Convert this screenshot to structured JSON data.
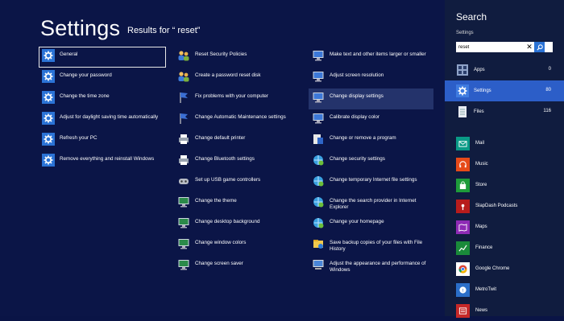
{
  "header": {
    "title": "Settings",
    "subtitle": "Results for “ reset”"
  },
  "columns": [
    [
      {
        "label": "General",
        "icon": "gear-icon",
        "focused": true
      },
      {
        "label": "Change your password",
        "icon": "gear-icon"
      },
      {
        "label": "Change the time zone",
        "icon": "gear-icon"
      },
      {
        "label": "Adjust for daylight saving time automatically",
        "icon": "gear-icon"
      },
      {
        "label": "Refresh your PC",
        "icon": "gear-icon"
      },
      {
        "label": "Remove everything and reinstall Windows",
        "icon": "gear-icon"
      }
    ],
    [
      {
        "label": "Reset Security Policies",
        "icon": "users-icon"
      },
      {
        "label": "Create a password reset disk",
        "icon": "users-icon"
      },
      {
        "label": "Fix problems with your computer",
        "icon": "flag-icon"
      },
      {
        "label": "Change Automatic Maintenance settings",
        "icon": "flag-icon"
      },
      {
        "label": "Change default printer",
        "icon": "printer-icon"
      },
      {
        "label": "Change Bluetooth settings",
        "icon": "printer-icon"
      },
      {
        "label": "Set up USB game controllers",
        "icon": "gamepad-icon"
      },
      {
        "label": "Change the theme",
        "icon": "monitor-icon"
      },
      {
        "label": "Change desktop background",
        "icon": "monitor-icon"
      },
      {
        "label": "Change window colors",
        "icon": "monitor-icon"
      },
      {
        "label": "Change screen saver",
        "icon": "monitor-icon"
      }
    ],
    [
      {
        "label": "Make text and other items larger or smaller",
        "icon": "display-icon"
      },
      {
        "label": "Adjust screen resolution",
        "icon": "display-icon"
      },
      {
        "label": "Change display settings",
        "icon": "display-icon",
        "highlighted": true
      },
      {
        "label": "Calibrate display color",
        "icon": "display-icon"
      },
      {
        "label": "Change or remove a program",
        "icon": "program-icon"
      },
      {
        "label": "Change security settings",
        "icon": "internet-options-icon"
      },
      {
        "label": "Change temporary Internet file settings",
        "icon": "internet-options-icon"
      },
      {
        "label": "Change the search provider in Internet Explorer",
        "icon": "internet-options-icon"
      },
      {
        "label": "Change your homepage",
        "icon": "internet-options-icon"
      },
      {
        "label": "Save backup copies of your files with File History",
        "icon": "file-history-icon"
      },
      {
        "label": "Adjust the appearance and performance of Windows",
        "icon": "computer-icon"
      }
    ]
  ],
  "search": {
    "title": "Search",
    "scope": "Settings",
    "query": "reset",
    "scopes": [
      {
        "label": "Apps",
        "count": "0",
        "icon": "apps-icon"
      },
      {
        "label": "Settings",
        "count": "80",
        "icon": "settings-icon",
        "selected": true
      },
      {
        "label": "Files",
        "count": "116",
        "icon": "files-icon"
      }
    ],
    "apps": [
      {
        "label": "Mail",
        "color": "#0a9a86",
        "icon": "mail-icon"
      },
      {
        "label": "Music",
        "color": "#e64a19",
        "icon": "headphones-icon"
      },
      {
        "label": "Store",
        "color": "#1e9b3a",
        "icon": "shopping-bag-icon"
      },
      {
        "label": "SlapDash Podcasts",
        "color": "#b71c1c",
        "icon": "podcast-icon"
      },
      {
        "label": "Maps",
        "color": "#8e2bb5",
        "icon": "map-icon"
      },
      {
        "label": "Finance",
        "color": "#1a8a3a",
        "icon": "chart-icon"
      },
      {
        "label": "Google Chrome",
        "color": "#ffffff",
        "icon": "chrome-icon"
      },
      {
        "label": "MetroTwit",
        "color": "#2a6ec9",
        "icon": "twitter-bird-icon"
      },
      {
        "label": "News",
        "color": "#c62828",
        "icon": "newspaper-icon"
      }
    ]
  }
}
